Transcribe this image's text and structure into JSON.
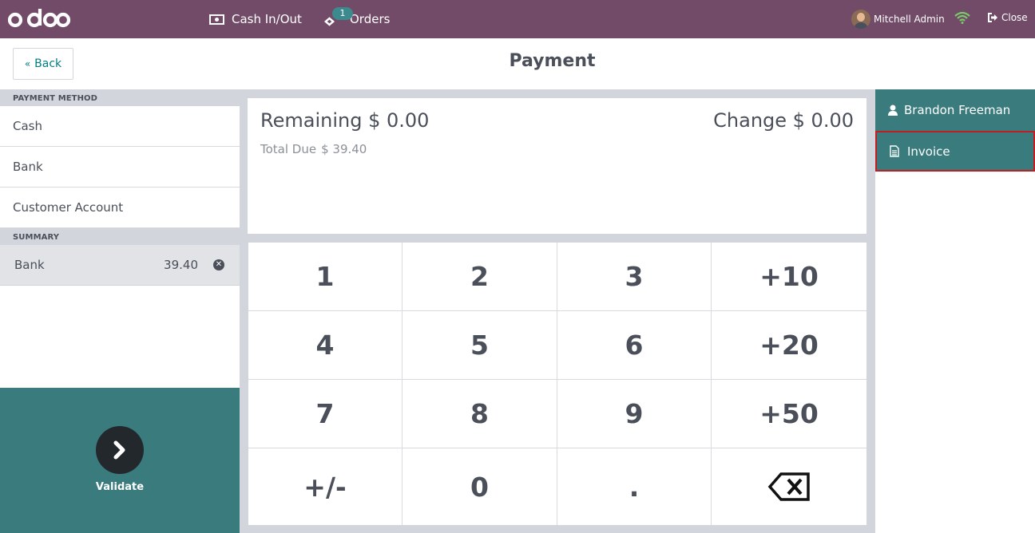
{
  "topbar": {
    "logo_text": "odoo",
    "cash_label": "Cash In/Out",
    "orders_label": "Orders",
    "orders_badge": "1",
    "user_name": "Mitchell Admin",
    "close_label": "Close",
    "colors": {
      "bar": "#714b67",
      "badge": "#3c8a8e",
      "wifi": "#7bc96a"
    }
  },
  "header": {
    "back_label": "Back",
    "title": "Payment"
  },
  "left": {
    "payment_method_label": "PAYMENT METHOD",
    "methods": [
      "Cash",
      "Bank",
      "Customer Account"
    ],
    "summary_label": "SUMMARY",
    "summary_line": {
      "method": "Bank",
      "amount": "39.40"
    },
    "validate_label": "Validate"
  },
  "status": {
    "remaining": "Remaining $ 0.00",
    "change": "Change $ 0.00",
    "total_due_label": "Total Due",
    "total_due_value": "$ 39.40"
  },
  "numpad": {
    "keys": [
      "1",
      "2",
      "3",
      "+10",
      "4",
      "5",
      "6",
      "+20",
      "7",
      "8",
      "9",
      "+50",
      "+/-",
      "0",
      ".",
      "backspace-icon"
    ]
  },
  "right": {
    "customer_label": "Brandon Freeman",
    "invoice_label": "Invoice",
    "colors": {
      "accent": "#3a7b7e",
      "highlight": "#c01e22"
    }
  }
}
